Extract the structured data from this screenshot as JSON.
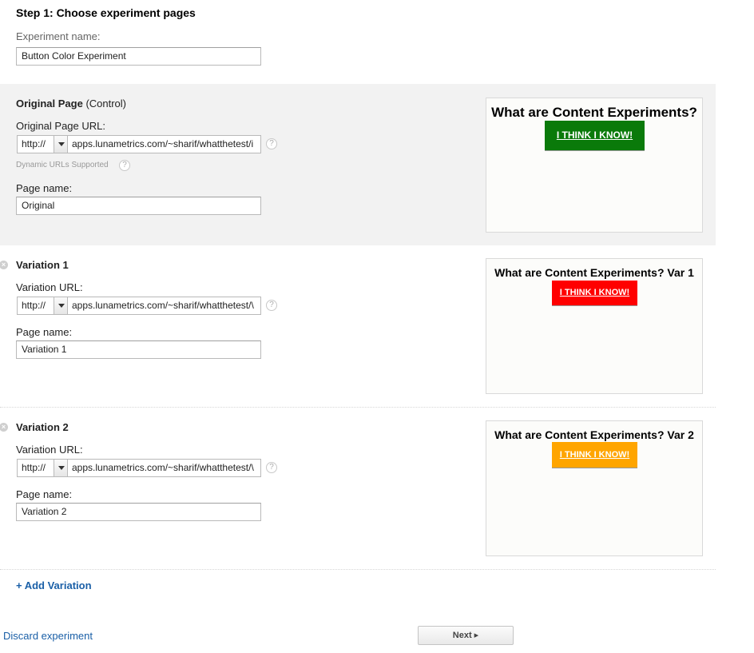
{
  "step": {
    "title": "Step 1: Choose experiment pages"
  },
  "experiment": {
    "name_label": "Experiment name:",
    "name_value": "Button Color Experiment"
  },
  "original": {
    "heading": "Original Page",
    "heading_suffix": "(Control)",
    "url_label": "Original Page URL:",
    "protocol": "http://",
    "url": "apps.lunametrics.com/~sharif/whatthetest/i",
    "dynamic_note": "Dynamic URLs Supported",
    "page_name_label": "Page name:",
    "page_name": "Original",
    "preview": {
      "title": "What are Content Experiments?",
      "button_label": "I THINK I KNOW!",
      "button_color": "#0a7a0a"
    }
  },
  "variations": [
    {
      "heading": "Variation 1",
      "url_label": "Variation URL:",
      "protocol": "http://",
      "url": "apps.lunametrics.com/~sharif/whatthetest/\\",
      "page_name_label": "Page name:",
      "page_name": "Variation 1",
      "preview": {
        "title": "What are Content Experiments? Var 1",
        "button_label": "I THINK I KNOW!",
        "button_color": "#ff0000"
      }
    },
    {
      "heading": "Variation 2",
      "url_label": "Variation URL:",
      "protocol": "http://",
      "url": "apps.lunametrics.com/~sharif/whatthetest/\\",
      "page_name_label": "Page name:",
      "page_name": "Variation 2",
      "preview": {
        "title": "What are Content Experiments? Var 2",
        "button_label": "I THINK I KNOW!",
        "button_color": "#ffa500"
      }
    }
  ],
  "actions": {
    "add_variation": "+ Add Variation",
    "discard": "Discard experiment",
    "next": "Next ▸"
  },
  "icons": {
    "help": "?",
    "remove": "×"
  }
}
